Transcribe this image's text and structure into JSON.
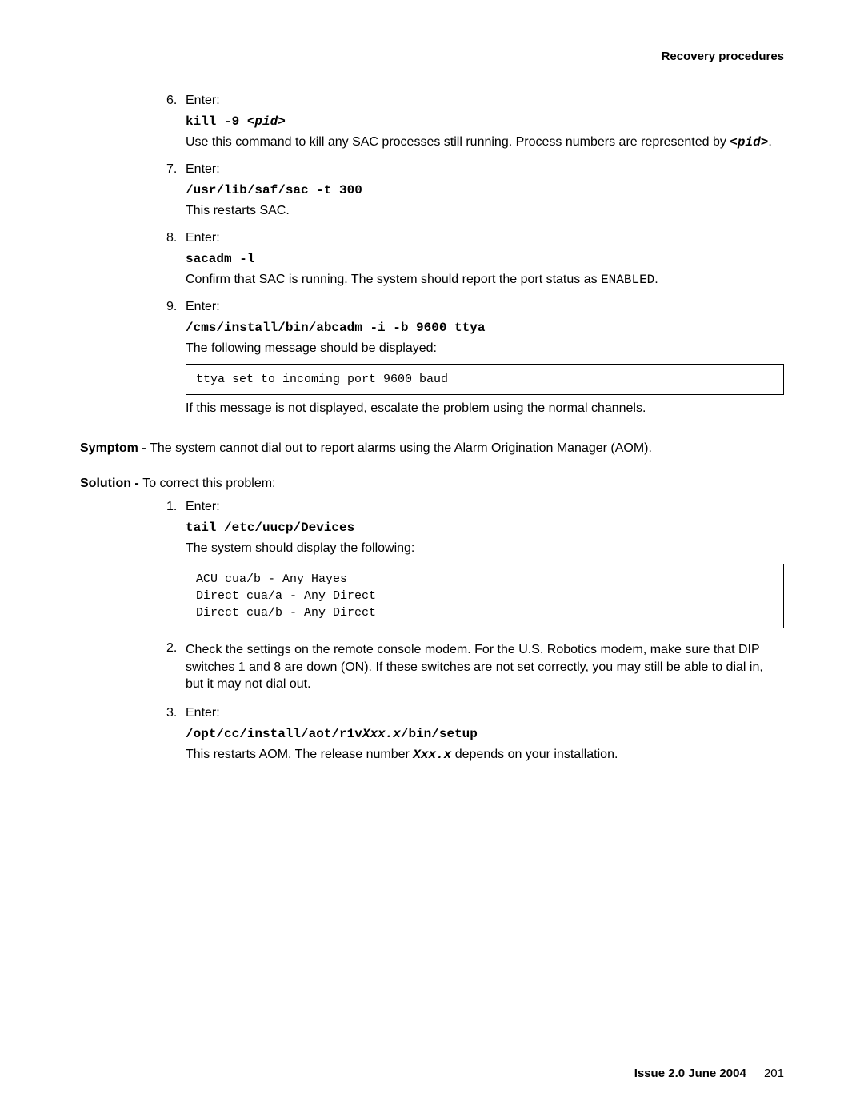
{
  "header": {
    "section": "Recovery procedures"
  },
  "listA": {
    "items": [
      {
        "num": "6.",
        "intro": "Enter:",
        "cmd_prefix": "kill -9 ",
        "cmd_var": "<pid>",
        "desc_before": "Use this command to kill any SAC processes still running. Process numbers are represented by ",
        "desc_var": "<pid>",
        "desc_after": "."
      },
      {
        "num": "7.",
        "intro": "Enter:",
        "cmd": "/usr/lib/saf/sac -t 300",
        "desc": "This restarts SAC."
      },
      {
        "num": "8.",
        "intro": "Enter:",
        "cmd": "sacadm -l",
        "desc_before": "Confirm that SAC is running. The system should report the port status as ",
        "desc_code": "ENABLED",
        "desc_after": "."
      },
      {
        "num": "9.",
        "intro": "Enter:",
        "cmd": "/cms/install/bin/abcadm -i -b 9600 ttya",
        "desc": "The following message should be displayed:",
        "output": "ttya set to incoming port 9600 baud",
        "after": "If this message is not displayed, escalate the problem using the normal channels."
      }
    ]
  },
  "symptom": {
    "label": "Symptom - ",
    "text": "The system cannot dial out to report alarms using the Alarm Origination Manager (AOM)."
  },
  "solution": {
    "label": "Solution - ",
    "text": "To correct this problem:"
  },
  "listB": {
    "items": [
      {
        "num": "1.",
        "intro": "Enter:",
        "cmd": "tail /etc/uucp/Devices",
        "desc": "The system should display the following:",
        "output": "ACU cua/b - Any Hayes\nDirect cua/a - Any Direct\nDirect cua/b - Any Direct"
      },
      {
        "num": "2.",
        "text": "Check the settings on the remote console modem. For the U.S. Robotics modem, make sure that DIP switches 1 and 8 are down (ON). If these switches are not set correctly, you may still be able to dial in, but it may not dial out."
      },
      {
        "num": "3.",
        "intro": "Enter:",
        "cmd_before": "/opt/cc/install/aot/r1v",
        "cmd_var": "Xxx.x",
        "cmd_after": "/bin/setup",
        "desc_before": "This restarts AOM. The release number ",
        "desc_var": "Xxx.x",
        "desc_after": " depends on your installation."
      }
    ]
  },
  "footer": {
    "issue": "Issue 2.0   June 2004",
    "page": "201"
  }
}
